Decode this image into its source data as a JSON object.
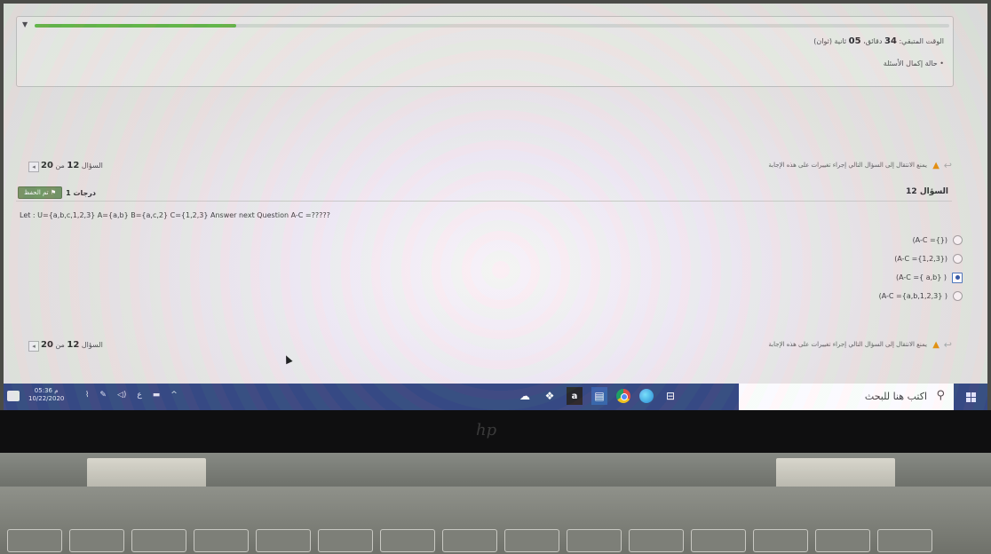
{
  "timer": {
    "prefix": "الوقت المتبقي:",
    "value": "34",
    "middle": "دقائق",
    "value2": "05",
    "suffix": "ثانية (ثوان)",
    "progress_percent": 22
  },
  "status_link": "حالة إكمال الأسئلة",
  "nav": {
    "warning": "يمنع الانتقال إلى السؤال التالي إجراء تغييرات على هذه الإجابة",
    "page_label": "السؤال",
    "current": "12",
    "of_label": "من",
    "total": "20"
  },
  "question": {
    "label": "السؤال 12",
    "grade": "1 درجات",
    "flag_label": "تم الحفظ",
    "text": "Let : U={a,b,c,1,2,3} A={a,b} B={a,c,2} C={1,2,3} Answer next Question A-C =?????",
    "choices": [
      {
        "label": "(A-C ={})",
        "selected": false
      },
      {
        "label": "(A-C ={1,2,3})",
        "selected": false
      },
      {
        "label": "(A-C ={ a,b} )",
        "selected": true
      },
      {
        "label": "(A-C ={a,b,1,2,3} )",
        "selected": false
      }
    ]
  },
  "taskbar": {
    "time": "05:36 م",
    "date": "10/22/2020",
    "search_placeholder": "اكتب هنا للبحث",
    "tray_icons": [
      "network-icon",
      "pen-icon",
      "volume-icon",
      "language-icon",
      "battery-icon",
      "chevron-up-icon"
    ],
    "apps": [
      "task-view-icon",
      "dropbox-icon",
      "amazon-icon",
      "store-icon",
      "chrome-icon",
      "edge-icon",
      "file-explorer-icon"
    ]
  },
  "device": {
    "brand": "hp"
  }
}
